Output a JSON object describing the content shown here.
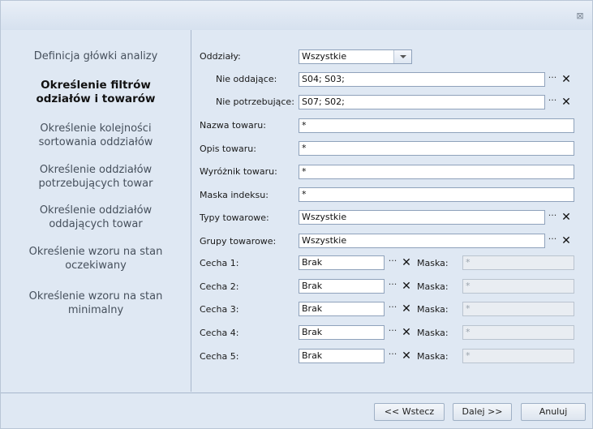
{
  "window": {
    "close_icon": "close-icon",
    "close_glyph": "⊠"
  },
  "steps": [
    "Definicja główki analizy",
    "Określenie filtrów odziałów i towarów",
    "Określenie kolejności sortowania oddziałów",
    "Określenie oddziałów potrzebujących towar",
    "Określenie oddziałów oddających towar",
    "Określenie wzoru na stan oczekiwany",
    "Określenie wzoru na stan minimalny"
  ],
  "form": {
    "oddzialy_label": "Oddziały:",
    "oddzialy_value": "Wszystkie",
    "nie_oddajace_label": "Nie oddające:",
    "nie_oddajace_value": "S04; S03;",
    "nie_potrzebujace_label": "Nie potrzebujące:",
    "nie_potrzebujace_value": "S07; S02;",
    "nazwa_label": "Nazwa towaru:",
    "nazwa_value": "*",
    "opis_label": "Opis towaru:",
    "opis_value": "*",
    "wyroznik_label": "Wyróżnik towaru:",
    "wyroznik_value": "*",
    "maska_indeksu_label": "Maska indeksu:",
    "maska_indeksu_value": "*",
    "typy_label": "Typy towarowe:",
    "typy_value": "Wszystkie",
    "grupy_label": "Grupy towarowe:",
    "grupy_value": "Wszystkie",
    "dots": "···",
    "x": "✕",
    "maska_label": "Maska:",
    "cechy": [
      {
        "label": "Cecha 1:",
        "value": "Brak",
        "mask": "*"
      },
      {
        "label": "Cecha 2:",
        "value": "Brak",
        "mask": "*"
      },
      {
        "label": "Cecha 3:",
        "value": "Brak",
        "mask": "*"
      },
      {
        "label": "Cecha 4:",
        "value": "Brak",
        "mask": "*"
      },
      {
        "label": "Cecha 5:",
        "value": "Brak",
        "mask": "*"
      }
    ]
  },
  "footer": {
    "back": "<< Wstecz",
    "next": "Dalej >>",
    "cancel": "Anuluj"
  }
}
